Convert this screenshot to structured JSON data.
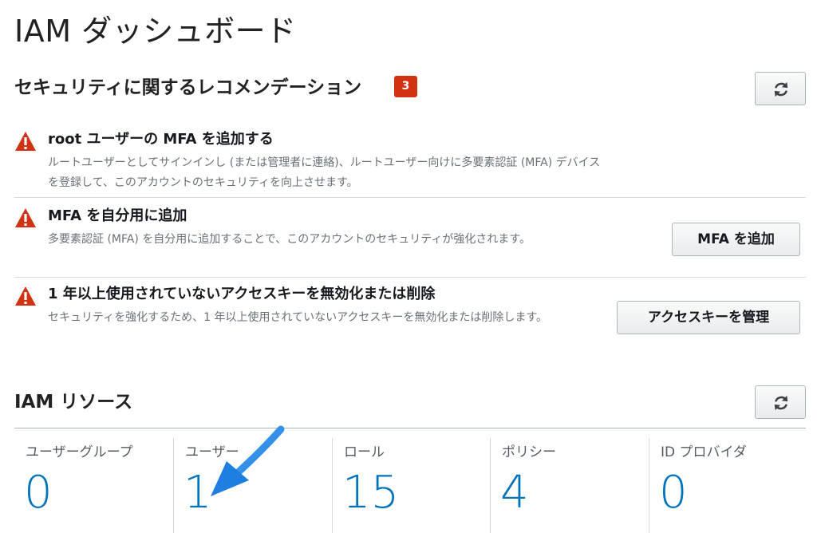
{
  "page": {
    "title": "IAM ダッシュボード"
  },
  "recommendations": {
    "heading": "セキュリティに関するレコメンデーション",
    "badge_count": "3",
    "items": [
      {
        "title": "root ユーザーの MFA を追加する",
        "description": "ルートユーザーとしてサインインし (または管理者に連絡)、ルートユーザー向けに多要素認証 (MFA) デバイスを登録して、このアカウントのセキュリティを向上させます。",
        "icon": "warning-icon"
      },
      {
        "title": "MFA を自分用に追加",
        "description": "多要素認証 (MFA) を自分用に追加することで、このアカウントのセキュリティが強化されます。",
        "button": "MFA を追加",
        "icon": "warning-icon"
      },
      {
        "title": "1 年以上使用されていないアクセスキーを無効化または削除",
        "description": "セキュリティを強化するため、1 年以上使用されていないアクセスキーを無効化または削除します。",
        "button": "アクセスキーを管理",
        "icon": "warning-icon"
      }
    ]
  },
  "resources": {
    "heading": "IAM リソース",
    "items": [
      {
        "label": "ユーザーグループ",
        "count": "0"
      },
      {
        "label": "ユーザー",
        "count": "1"
      },
      {
        "label": "ロール",
        "count": "15"
      },
      {
        "label": "ポリシー",
        "count": "4"
      },
      {
        "label": "ID プロバイダ",
        "count": "0"
      }
    ]
  },
  "colors": {
    "accent": "#0073bb",
    "warning": "#d13212",
    "annotation_arrow": "#2b8be6"
  },
  "icons": {
    "refresh": "refresh-icon",
    "warning": "warning-icon",
    "annotation": "annotation-arrow"
  }
}
